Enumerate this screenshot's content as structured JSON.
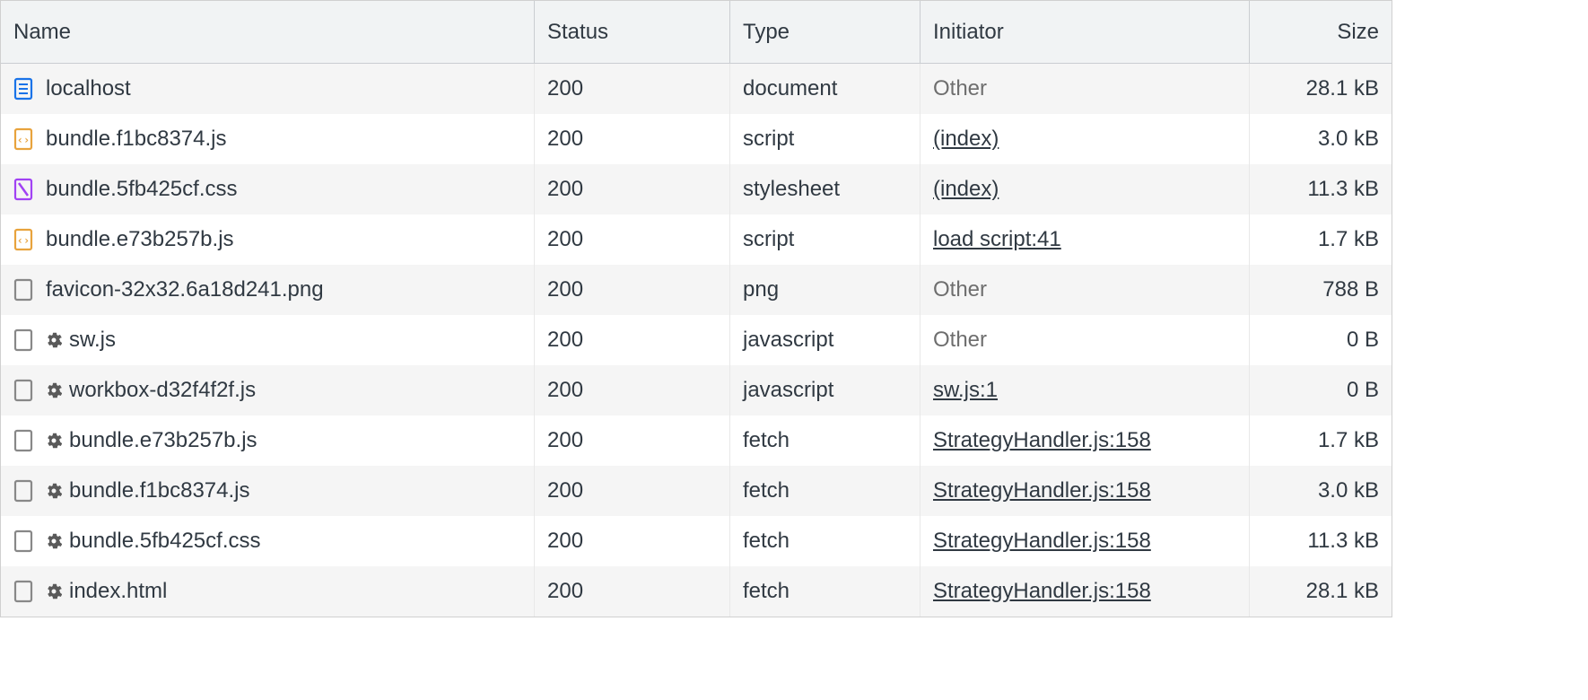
{
  "columns": {
    "name": "Name",
    "status": "Status",
    "type": "Type",
    "initiator": "Initiator",
    "size": "Size"
  },
  "rows": [
    {
      "icon": "document",
      "gear": false,
      "name": "localhost",
      "status": "200",
      "type": "document",
      "initiator": "Other",
      "initiator_link": false,
      "size": "28.1 kB"
    },
    {
      "icon": "js",
      "gear": false,
      "name": "bundle.f1bc8374.js",
      "status": "200",
      "type": "script",
      "initiator": "(index)",
      "initiator_link": true,
      "size": "3.0 kB"
    },
    {
      "icon": "css",
      "gear": false,
      "name": "bundle.5fb425cf.css",
      "status": "200",
      "type": "stylesheet",
      "initiator": "(index)",
      "initiator_link": true,
      "size": "11.3 kB"
    },
    {
      "icon": "js",
      "gear": false,
      "name": "bundle.e73b257b.js",
      "status": "200",
      "type": "script",
      "initiator": "load script:41",
      "initiator_link": true,
      "size": "1.7 kB"
    },
    {
      "icon": "generic",
      "gear": false,
      "name": "favicon-32x32.6a18d241.png",
      "status": "200",
      "type": "png",
      "initiator": "Other",
      "initiator_link": false,
      "size": "788 B"
    },
    {
      "icon": "generic",
      "gear": true,
      "name": "sw.js",
      "status": "200",
      "type": "javascript",
      "initiator": "Other",
      "initiator_link": false,
      "size": "0 B"
    },
    {
      "icon": "generic",
      "gear": true,
      "name": "workbox-d32f4f2f.js",
      "status": "200",
      "type": "javascript",
      "initiator": "sw.js:1",
      "initiator_link": true,
      "size": "0 B"
    },
    {
      "icon": "generic",
      "gear": true,
      "name": "bundle.e73b257b.js",
      "status": "200",
      "type": "fetch",
      "initiator": "StrategyHandler.js:158",
      "initiator_link": true,
      "size": "1.7 kB"
    },
    {
      "icon": "generic",
      "gear": true,
      "name": "bundle.f1bc8374.js",
      "status": "200",
      "type": "fetch",
      "initiator": "StrategyHandler.js:158",
      "initiator_link": true,
      "size": "3.0 kB"
    },
    {
      "icon": "generic",
      "gear": true,
      "name": "bundle.5fb425cf.css",
      "status": "200",
      "type": "fetch",
      "initiator": "StrategyHandler.js:158",
      "initiator_link": true,
      "size": "11.3 kB"
    },
    {
      "icon": "generic",
      "gear": true,
      "name": "index.html",
      "status": "200",
      "type": "fetch",
      "initiator": "StrategyHandler.js:158",
      "initiator_link": true,
      "size": "28.1 kB"
    }
  ]
}
